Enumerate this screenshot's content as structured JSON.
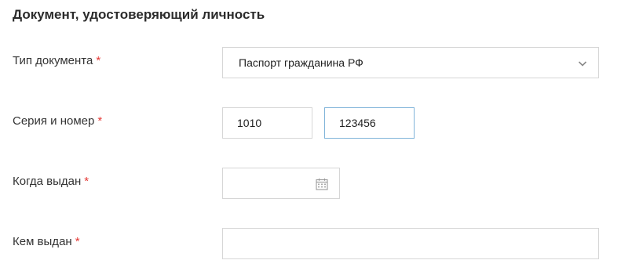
{
  "section": {
    "title": "Документ, удостоверяющий личность"
  },
  "fields": {
    "doc_type": {
      "label": "Тип документа",
      "required_mark": "*",
      "value": "Паспорт гражданина РФ",
      "icon": "chevron-down-icon"
    },
    "series_number": {
      "label": "Серия и номер",
      "required_mark": "*",
      "series_value": "1010",
      "number_value": "123456"
    },
    "issue_date": {
      "label": "Когда выдан",
      "required_mark": "*",
      "value": "",
      "icon": "calendar-icon"
    },
    "issued_by": {
      "label": "Кем выдан",
      "required_mark": "*",
      "value": ""
    }
  },
  "colors": {
    "required": "#e53935",
    "border": "#d6d6d6",
    "focus_border": "#7fb3d9",
    "text": "#333333"
  }
}
